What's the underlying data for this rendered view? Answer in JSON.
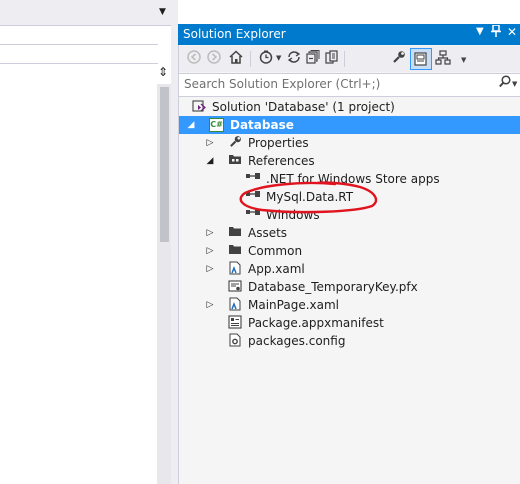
{
  "editor": {
    "splitter_glyph": "⇕"
  },
  "solution_explorer": {
    "title": "Solution Explorer",
    "title_buttons": {
      "pin": "▼",
      "autohide": "⮋",
      "close": "✕"
    },
    "search": {
      "placeholder": "Search Solution Explorer (Ctrl+;)",
      "value": ""
    },
    "toolbar": {
      "buttons": [
        "back-icon",
        "forward-icon",
        "home-icon",
        "pending-changes-icon",
        "sync-icon",
        "collapse-all-icon",
        "show-all-files-icon",
        "properties-icon",
        "preview-icon",
        "view-class-diagram-icon"
      ]
    },
    "tree": [
      {
        "label": "Solution 'Database' (1 project)",
        "icon": "solution-icon",
        "toggle": "",
        "selected": false
      },
      {
        "label": "Database",
        "icon": "csharp-project-icon",
        "toggle": "expanded",
        "selected": true
      },
      {
        "label": "Properties",
        "icon": "wrench-icon",
        "toggle": "collapsed",
        "selected": false
      },
      {
        "label": "References",
        "icon": "references-folder-icon",
        "toggle": "expanded",
        "selected": false
      },
      {
        "label": ".NET for Windows Store apps",
        "icon": "reference-icon",
        "toggle": "",
        "selected": false
      },
      {
        "label": "MySql.Data.RT",
        "icon": "reference-icon",
        "toggle": "",
        "selected": false
      },
      {
        "label": "Windows",
        "icon": "reference-icon",
        "toggle": "",
        "selected": false
      },
      {
        "label": "Assets",
        "icon": "folder-icon",
        "toggle": "collapsed",
        "selected": false
      },
      {
        "label": "Common",
        "icon": "folder-icon",
        "toggle": "collapsed",
        "selected": false
      },
      {
        "label": "App.xaml",
        "icon": "xaml-icon",
        "toggle": "collapsed",
        "selected": false
      },
      {
        "label": "Database_TemporaryKey.pfx",
        "icon": "certificate-icon",
        "toggle": "",
        "selected": false
      },
      {
        "label": "MainPage.xaml",
        "icon": "xaml-icon",
        "toggle": "collapsed",
        "selected": false
      },
      {
        "label": "Package.appxmanifest",
        "icon": "manifest-icon",
        "toggle": "",
        "selected": false
      },
      {
        "label": "packages.config",
        "icon": "config-file-icon",
        "toggle": "",
        "selected": false
      }
    ]
  },
  "colors": {
    "accent": "#007acc",
    "selection": "#3399ff",
    "annotation": "#e0141e"
  }
}
